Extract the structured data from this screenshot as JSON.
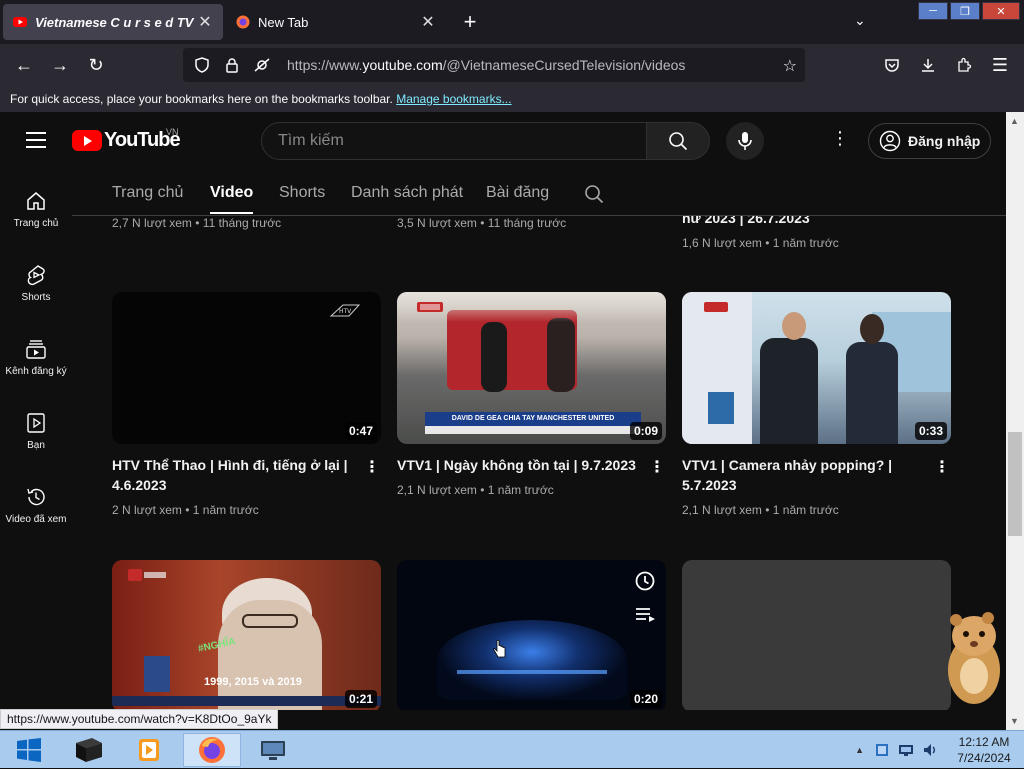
{
  "browser": {
    "tabs": [
      {
        "title": "Vietnamese C u r s e d TV - Yo",
        "active": true
      },
      {
        "title": "New Tab",
        "active": false
      }
    ],
    "url_prefix": "https://www.",
    "url_domain": "youtube.com",
    "url_path": "/@VietnameseCursedTelevision/videos",
    "bookmarks_text": "For quick access, place your bookmarks here on the bookmarks toolbar.",
    "bookmarks_link": "Manage bookmarks...",
    "status_url": "https://www.youtube.com/watch?v=K8DtOo_9aYk"
  },
  "youtube": {
    "logo_text": "YouTube",
    "country_code": "VN",
    "search_placeholder": "Tìm kiếm",
    "signin_label": "Đăng nhập",
    "leftnav": [
      {
        "label": "Trang chủ",
        "icon": "home-icon"
      },
      {
        "label": "Shorts",
        "icon": "shorts-icon"
      },
      {
        "label": "Kênh đăng ký",
        "icon": "subscriptions-icon"
      },
      {
        "label": "Bạn",
        "icon": "you-icon"
      },
      {
        "label": "Video đã xem",
        "icon": "history-icon"
      }
    ],
    "channel_tabs": [
      "Trang chủ",
      "Video",
      "Shorts",
      "Danh sách phát",
      "Bài đăng"
    ],
    "active_tab": "Video",
    "previous_row": [
      {
        "meta": "2,7 N lượt xem • 11 tháng trước"
      },
      {
        "meta": "3,5 N lượt xem • 11 tháng trước"
      },
      {
        "title_fragment": "nư 2023 | 26.7.2023",
        "meta": "1,6 N lượt xem • 1 năm trước"
      }
    ],
    "videos": [
      {
        "title": "HTV Thể Thao | Hình đi, tiếng ở lại | 4.6.2023",
        "meta": "2 N lượt xem • 1 năm trước",
        "duration": "0:47"
      },
      {
        "title": "VTV1 | Ngày không tồn tại | 9.7.2023",
        "meta": "2,1 N lượt xem • 1 năm trước",
        "duration": "0:09"
      },
      {
        "title": "VTV1 | Camera nhảy popping? | 5.7.2023",
        "meta": "2,1 N lượt xem • 1 năm trước",
        "duration": "0:33"
      },
      {
        "title": "",
        "meta": "",
        "duration": "0:21"
      },
      {
        "title": "",
        "meta": "",
        "duration": "0:20"
      },
      {
        "title": "",
        "meta": "",
        "duration": ""
      }
    ],
    "thumb_texts": {
      "v2_caption": "DAVID DE GEA CHIA TAY MANCHESTER UNITED",
      "v4_caption": "1999, 2015 và 2019",
      "v4_tag": "#NGHĨA"
    }
  },
  "taskbar": {
    "time": "12:12 AM",
    "date": "7/24/2024"
  }
}
